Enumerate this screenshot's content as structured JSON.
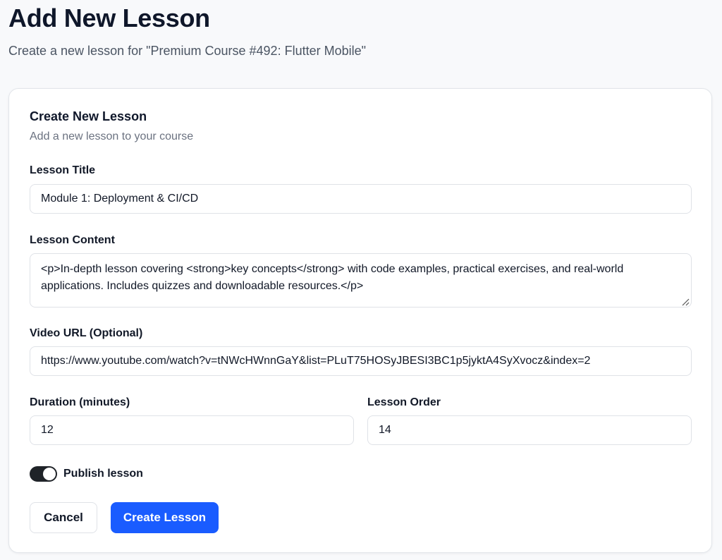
{
  "page": {
    "title": "Add New Lesson",
    "subtitle": "Create a new lesson for \"Premium Course #492: Flutter Mobile\""
  },
  "card": {
    "title": "Create New Lesson",
    "subtitle": "Add a new lesson to your course"
  },
  "form": {
    "lesson_title": {
      "label": "Lesson Title",
      "value": "Module 1: Deployment & CI/CD"
    },
    "lesson_content": {
      "label": "Lesson Content",
      "value": "<p>In-depth lesson covering <strong>key concepts</strong> with code examples, practical exercises, and real-world applications. Includes quizzes and downloadable resources.</p>"
    },
    "video_url": {
      "label": "Video URL (Optional)",
      "value": "https://www.youtube.com/watch?v=tNWcHWnnGaY&list=PLuT75HOSyJBESI3BC1p5jyktA4SyXvocz&index=2"
    },
    "duration": {
      "label": "Duration (minutes)",
      "value": "12"
    },
    "lesson_order": {
      "label": "Lesson Order",
      "value": "14"
    },
    "publish": {
      "label": "Publish lesson",
      "enabled": true
    }
  },
  "actions": {
    "cancel_label": "Cancel",
    "create_label": "Create Lesson"
  },
  "colors": {
    "primary": "#1a5cff",
    "toggle_on": "#1f2328",
    "page_background": "#f8f9fb"
  }
}
